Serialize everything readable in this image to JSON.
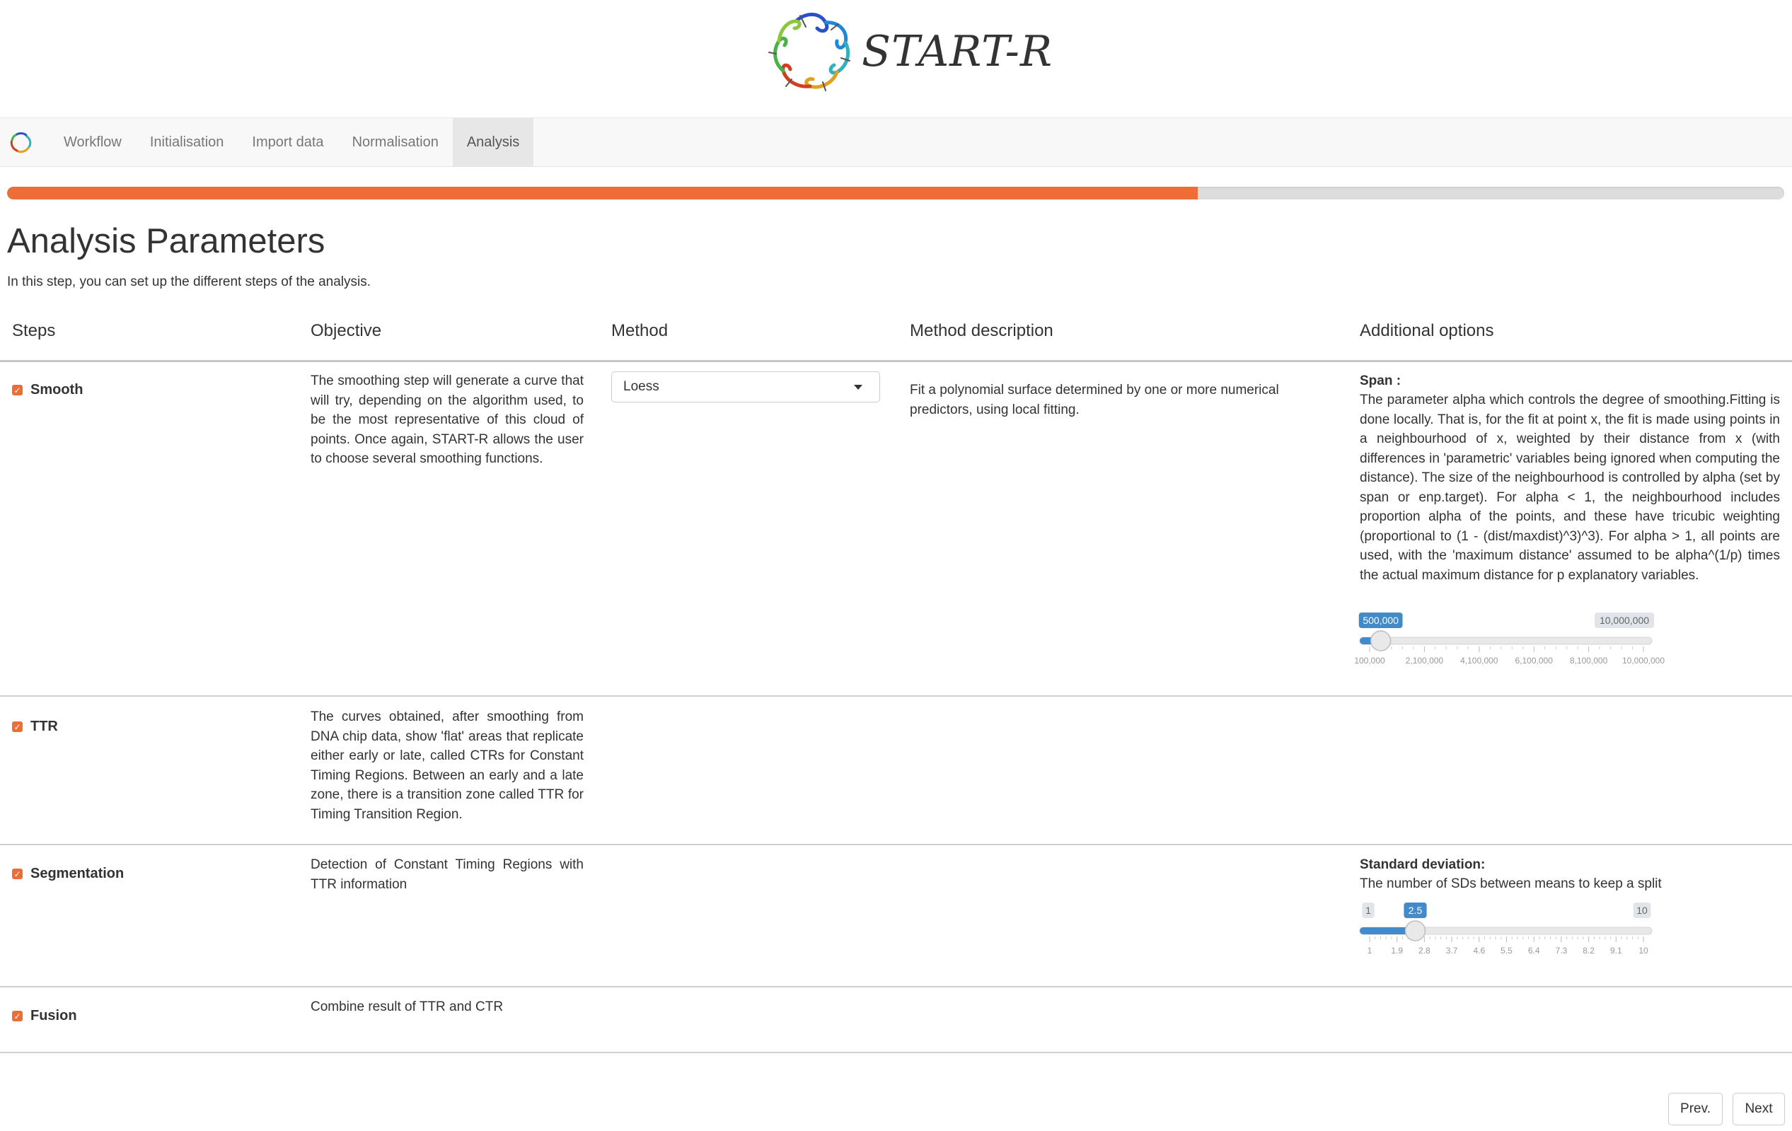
{
  "app": {
    "title": "START-R"
  },
  "nav": {
    "items": [
      {
        "label": "Workflow",
        "active": false
      },
      {
        "label": "Initialisation",
        "active": false
      },
      {
        "label": "Import data",
        "active": false
      },
      {
        "label": "Normalisation",
        "active": false
      },
      {
        "label": "Analysis",
        "active": true
      }
    ]
  },
  "progress": {
    "value_percent": 67,
    "color": "#ee6c36"
  },
  "page": {
    "title": "Analysis Parameters",
    "intro": "In this step, you can set up the different steps of the analysis."
  },
  "table": {
    "headers": {
      "steps": "Steps",
      "objective": "Objective",
      "method": "Method",
      "method_description": "Method description",
      "additional_options": "Additional options"
    },
    "rows": [
      {
        "step": "Smooth",
        "checked": true,
        "objective": "The smoothing step will generate a curve that will try, depending on the algorithm used, to be the most representative of this cloud of points. Once again, START-R allows the user to choose several smoothing functions.",
        "method": "Loess",
        "method_description": "Fit a polynomial surface determined by one or more numerical predictors, using local fitting.",
        "option_title": "Span :",
        "option_text": "The parameter alpha which controls the degree of smoothing.Fitting is done locally. That is, for the fit at point x, the fit is made using points in a neighbourhood of x, weighted by their distance from x (with differences in 'parametric' variables being ignored when computing the distance). The size of the neighbourhood is controlled by alpha (set by span or enp.target). For alpha < 1, the neighbourhood includes proportion alpha of the points, and these have tricubic weighting (proportional to (1 - (dist/maxdist)^3)^3). For alpha > 1, all points are used, with the 'maximum distance' assumed to be alpha^(1/p) times the actual maximum distance for p explanatory variables.",
        "slider": {
          "min": 100000,
          "max": 10000000,
          "value": 500000,
          "value_label": "500,000",
          "max_label": "10,000,000",
          "tick_labels": [
            "100,000",
            "2,100,000",
            "4,100,000",
            "6,100,000",
            "8,100,000",
            "10,000,000"
          ]
        }
      },
      {
        "step": "TTR",
        "checked": true,
        "objective": "The curves obtained, after smoothing from DNA chip data, show 'flat' areas that replicate either early or late, called CTRs for Constant Timing Regions. Between an early and a late zone, there is a transition zone called TTR for Timing Transition Region."
      },
      {
        "step": "Segmentation",
        "checked": true,
        "objective": "Detection of Constant Timing Regions with TTR information",
        "option_title": "Standard deviation:",
        "option_text": "The number of SDs between means to keep a split",
        "slider": {
          "min": 1,
          "max": 10,
          "value": 2.5,
          "min_label": "1",
          "value_label": "2.5",
          "max_label": "10",
          "tick_labels": [
            "1",
            "1.9",
            "2.8",
            "3.7",
            "4.6",
            "5.5",
            "6.4",
            "7.3",
            "8.2",
            "9.1",
            "10"
          ]
        }
      },
      {
        "step": "Fusion",
        "checked": true,
        "objective": "Combine result of TTR and CTR"
      }
    ]
  },
  "buttons": {
    "prev": "Prev.",
    "next": "Next"
  },
  "colors": {
    "accent": "#ee6c36",
    "slider_blue": "#428bca"
  }
}
